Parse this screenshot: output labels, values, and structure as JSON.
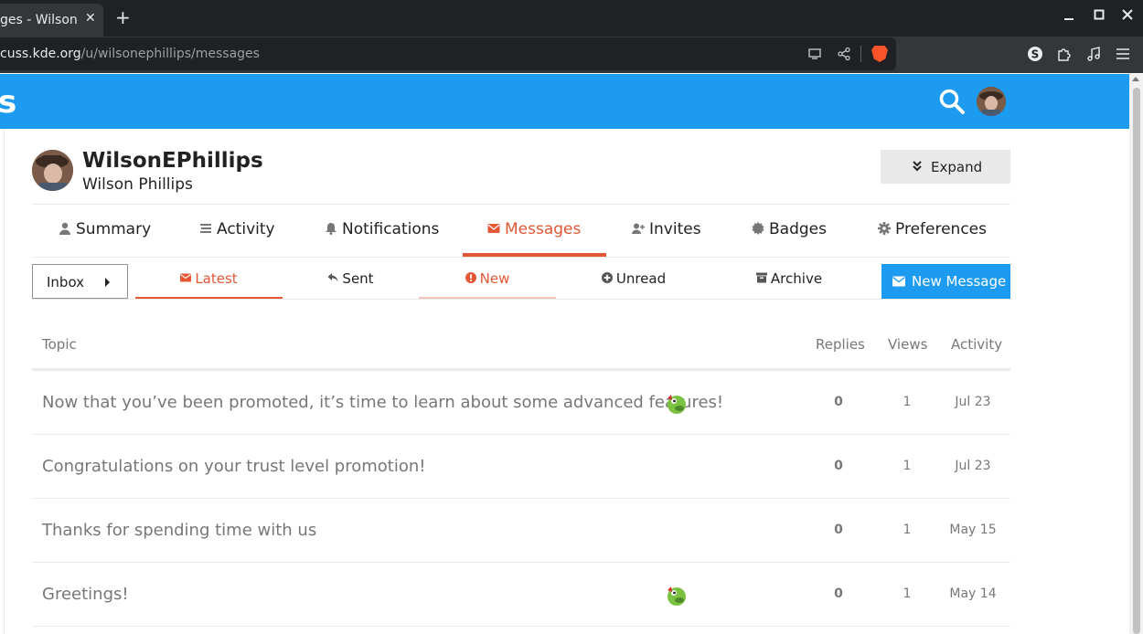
{
  "browser": {
    "tab_title": "ges - Wilson",
    "tab_close": "✕",
    "new_tab": "+",
    "url_host": "cuss.kde.org",
    "url_path": "/u/wilsonephillips/messages"
  },
  "header": {
    "logo_fragment": "s"
  },
  "user": {
    "username": "WilsonEPhillips",
    "full_name": "Wilson Phillips",
    "expand_label": "Expand"
  },
  "profile_nav": [
    {
      "label": "Summary",
      "icon": "user-icon"
    },
    {
      "label": "Activity",
      "icon": "stream-icon"
    },
    {
      "label": "Notifications",
      "icon": "bell-icon"
    },
    {
      "label": "Messages",
      "icon": "envelope-icon",
      "active": true
    },
    {
      "label": "Invites",
      "icon": "user-plus-icon"
    },
    {
      "label": "Badges",
      "icon": "certificate-icon"
    },
    {
      "label": "Preferences",
      "icon": "cog-icon"
    }
  ],
  "messages_nav": {
    "inbox_label": "Inbox",
    "items": [
      {
        "label": "Latest",
        "icon": "envelope-icon",
        "active": true
      },
      {
        "label": "Sent",
        "icon": "reply-icon"
      },
      {
        "label": "New",
        "icon": "exclamation-circle-icon"
      },
      {
        "label": "Unread",
        "icon": "plus-circle-icon"
      },
      {
        "label": "Archive",
        "icon": "archive-icon"
      }
    ],
    "new_message_label": "New Message"
  },
  "table": {
    "headers": {
      "topic": "Topic",
      "replies": "Replies",
      "views": "Views",
      "activity": "Activity"
    },
    "rows": [
      {
        "title": "Now that you’ve been promoted, it’s time to learn about some advanced features!",
        "has_poster": true,
        "replies": "0",
        "views": "1",
        "activity": "Jul 23"
      },
      {
        "title": "Congratulations on your trust level promotion!",
        "has_poster": false,
        "replies": "0",
        "views": "1",
        "activity": "Jul 23"
      },
      {
        "title": "Thanks for spending time with us",
        "has_poster": false,
        "replies": "0",
        "views": "1",
        "activity": "May 15"
      },
      {
        "title": "Greetings!",
        "has_poster": true,
        "replies": "0",
        "views": "1",
        "activity": "May 14"
      }
    ]
  },
  "colors": {
    "brand_blue": "#1d9bf0",
    "accent": "#e45735"
  }
}
